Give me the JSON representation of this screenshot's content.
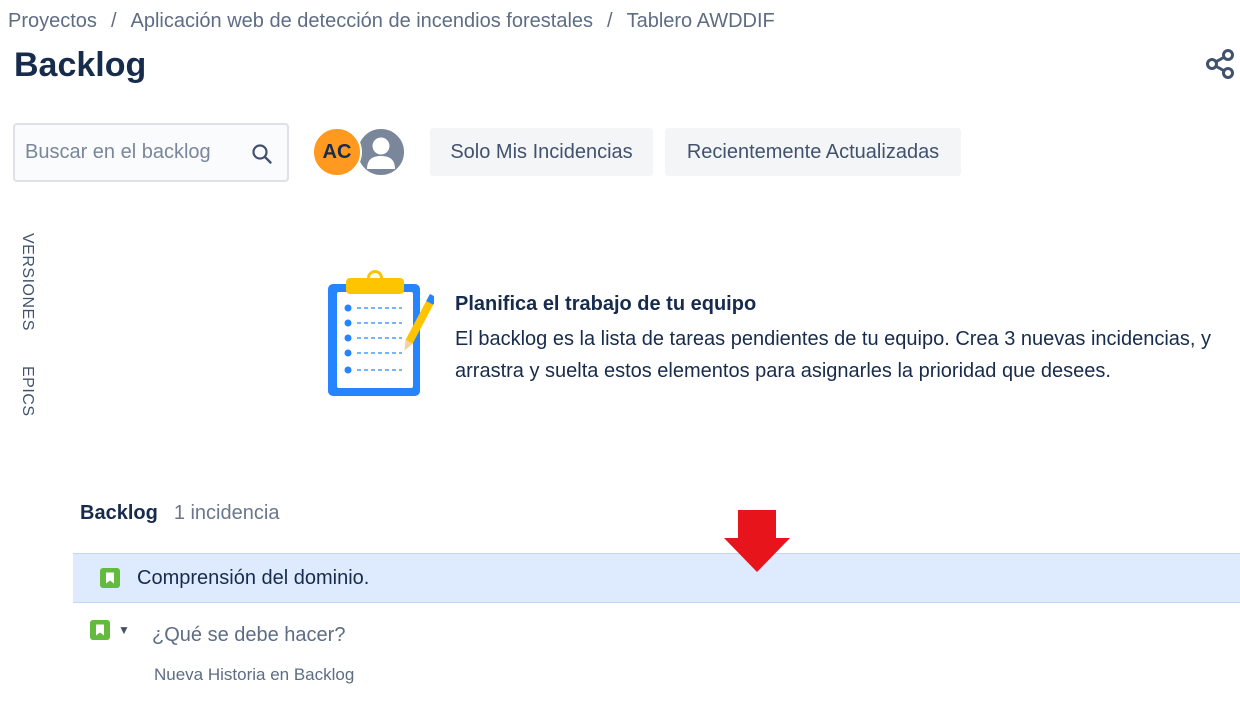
{
  "breadcrumb": {
    "items": [
      "Proyectos",
      "Aplicación web de detección de incendios forestales",
      "Tablero AWDDIF"
    ],
    "separator": "/"
  },
  "page": {
    "title": "Backlog"
  },
  "search": {
    "placeholder": "Buscar en el backlog",
    "value": ""
  },
  "avatars": [
    {
      "initials": "AC",
      "color": "#ff991f"
    },
    {
      "initials": "",
      "color": "#7a869a"
    }
  ],
  "filters": {
    "mine": "Solo Mis Incidencias",
    "recent": "Recientemente Actualizadas"
  },
  "side_tabs": {
    "versions": "VERSIONES",
    "epics": "EPICS"
  },
  "empty_state": {
    "title": "Planifica el trabajo de tu equipo",
    "description": "El backlog es la lista de tareas pendientes de tu equipo. Crea 3 nuevas incidencias, y arrastra y suelta estos elementos para asignarles la prioridad que desees."
  },
  "backlog": {
    "title": "Backlog",
    "count": "1 incidencia",
    "issues": [
      {
        "type_icon": "story-icon",
        "summary": "Comprensión del dominio."
      }
    ],
    "create": {
      "placeholder": "¿Qué se debe hacer?",
      "hint": "Nueva Historia en Backlog"
    }
  },
  "colors": {
    "brand_text": "#172b4d",
    "story_green": "#63ba3c",
    "selected_row": "#deebff",
    "avatar_orange": "#ff991f",
    "annotation_arrow": "#e8141c",
    "clipboard_blue": "#2684ff"
  }
}
